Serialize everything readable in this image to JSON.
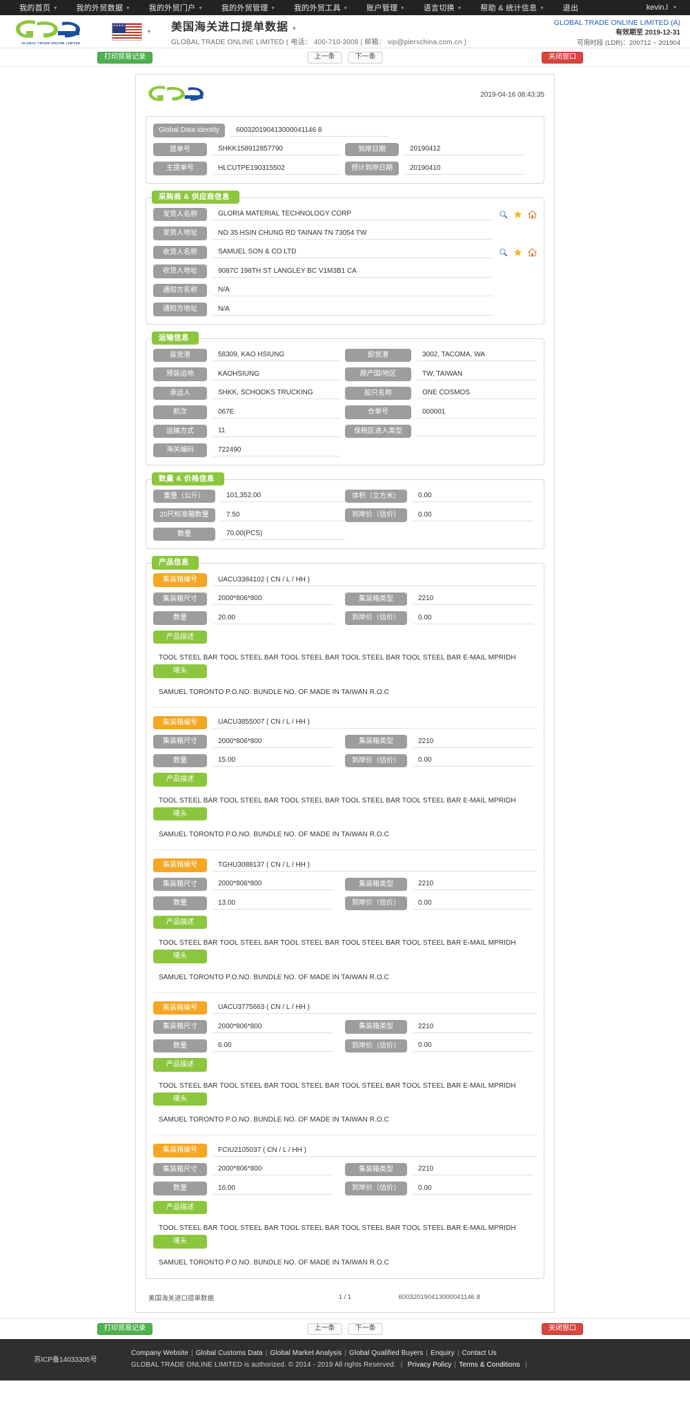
{
  "topnav": {
    "items": [
      {
        "label": "我的首页",
        "caret": true
      },
      {
        "label": "我的外贸数据",
        "caret": true
      },
      {
        "label": "我的外贸门户",
        "caret": true
      },
      {
        "label": "我的外贸管理",
        "caret": true
      },
      {
        "label": "我的外贸工具",
        "caret": true
      },
      {
        "label": "账户管理",
        "caret": true
      },
      {
        "label": "语言切换",
        "caret": true
      },
      {
        "label": "帮助 & 统计信息",
        "caret": true
      },
      {
        "label": "退出",
        "caret": false
      }
    ],
    "user": "kevin.l",
    "user_caret": "▾"
  },
  "brand": {
    "logo_text": "GLOBAL TRADE ONLINE LIMITED",
    "flag_name": "us-flag",
    "title": "美国海关进口提单数据",
    "title_caret": "▾",
    "subtitle": "GLOBAL TRADE ONLINE LIMITED ( 电话： 400-710-3008 | 邮箱： vip@pierschina.com.cn )",
    "account_name": "GLOBAL TRADE ONLINE LIMITED (A)",
    "account_valid": "有效期至 2019-12-31",
    "account_ldr": "可用时段 (LDR)：200712 ~ 201904"
  },
  "toolbar": {
    "print_label": "打印贸易记录",
    "prev_label": "上一条",
    "next_label": "下一条",
    "close_label": "关闭窗口"
  },
  "doc": {
    "timestamp": "2019-04-16 08:43:35",
    "identity": {
      "label": "Global Data Identity",
      "value": "600320190413000041146 8"
    },
    "header_fields": [
      {
        "label": "提单号",
        "value": "SHKK158912857790",
        "label2": "到岸日期",
        "value2": "20190412"
      },
      {
        "label": "主提单号",
        "value": "HLCUTPE190315502",
        "label2": "预计到岸日期",
        "value2": "20190410"
      }
    ],
    "buyer_section": {
      "title": "采购商 & 供应商信息",
      "rows": [
        {
          "label": "发货人名称",
          "value": "GLORIA MATERIAL TECHNOLOGY CORP",
          "icons": true
        },
        {
          "label": "发货人地址",
          "value": "NO 35 HSIN CHUNG RD TAINAN TN 73054 TW",
          "icons": false
        },
        {
          "label": "收货人名称",
          "value": "SAMUEL SON & CO LTD",
          "icons": true
        },
        {
          "label": "收货人地址",
          "value": "9087C 198TH ST LANGLEY BC V1M3B1 CA",
          "icons": false
        },
        {
          "label": "通知方名称",
          "value": "N/A",
          "icons": false
        },
        {
          "label": "通知方地址",
          "value": "N/A",
          "icons": false
        }
      ]
    },
    "transport_section": {
      "title": "运输信息",
      "rows": [
        {
          "label": "装货港",
          "value": "58309, KAO HSIUNG",
          "label2": "卸货港",
          "value2": "3002, TACOMA, WA"
        },
        {
          "label": "预装运地",
          "value": "KAOHSIUNG",
          "label2": "原产国/地区",
          "value2": "TW, TAIWAN"
        },
        {
          "label": "承运人",
          "value": "SHKK, SCHOOKS TRUCKING",
          "label2": "船只名称",
          "value2": "ONE COSMOS"
        },
        {
          "label": "航次",
          "value": "067E",
          "label2": "仓单号",
          "value2": "000001"
        },
        {
          "label": "运输方式",
          "value": "11",
          "label2": "保税区进入类型",
          "value2": ""
        },
        {
          "label": "海关编码",
          "value": "722490",
          "label2": "",
          "value2": ""
        }
      ]
    },
    "quantity_section": {
      "title": "数量 & 价格信息",
      "rows": [
        {
          "label": "重量（公斤）",
          "value": "101,352.00",
          "label2": "体积（立方米）",
          "value2": "0.00"
        },
        {
          "label": "20尺标准箱数量",
          "value": "7.50",
          "label2": "到岸价（估价）",
          "value2": "0.00"
        },
        {
          "label": "数量",
          "value": "70.00(PCS)",
          "label2": "",
          "value2": ""
        }
      ]
    },
    "product_section": {
      "title": "产品信息",
      "labels": {
        "container_no": "集装箱编号",
        "container_size": "集装箱尺寸",
        "container_type": "集装箱类型",
        "quantity": "数量",
        "price": "到岸价（估价）",
        "description": "产品描述",
        "marks": "唛头"
      },
      "items": [
        {
          "container_no": "UACU3384102 ( CN / L / HH )",
          "container_size": "2000*806*800",
          "container_type": "2210",
          "quantity": "20.00",
          "price": "0.00",
          "description": "TOOL STEEL BAR TOOL STEEL BAR TOOL STEEL BAR TOOL STEEL BAR TOOL STEEL BAR E-MAIL MPRIDH",
          "marks": "SAMUEL TORONTO P.O.NO. BUNDLE NO. OF MADE IN TAIWAN R.O.C"
        },
        {
          "container_no": "UACU3855007 ( CN / L / HH )",
          "container_size": "2000*806*800",
          "container_type": "2210",
          "quantity": "15.00",
          "price": "0.00",
          "description": "TOOL STEEL BAR TOOL STEEL BAR TOOL STEEL BAR TOOL STEEL BAR TOOL STEEL BAR E-MAIL MPRIDH",
          "marks": "SAMUEL TORONTO P.O.NO. BUNDLE NO. OF MADE IN TAIWAN R.O.C"
        },
        {
          "container_no": "TGHU3088137 ( CN / L / HH )",
          "container_size": "2000*806*800",
          "container_type": "2210",
          "quantity": "13.00",
          "price": "0.00",
          "description": "TOOL STEEL BAR TOOL STEEL BAR TOOL STEEL BAR TOOL STEEL BAR TOOL STEEL BAR E-MAIL MPRIDH",
          "marks": "SAMUEL TORONTO P.O.NO. BUNDLE NO. OF MADE IN TAIWAN R.O.C"
        },
        {
          "container_no": "UACU3775663 ( CN / L / HH )",
          "container_size": "2000*806*800",
          "container_type": "2210",
          "quantity": "6.00",
          "price": "0.00",
          "description": "TOOL STEEL BAR TOOL STEEL BAR TOOL STEEL BAR TOOL STEEL BAR TOOL STEEL BAR E-MAIL MPRIDH",
          "marks": "SAMUEL TORONTO P.O.NO. BUNDLE NO. OF MADE IN TAIWAN R.O.C"
        },
        {
          "container_no": "FCIU2105037 ( CN / L / HH )",
          "container_size": "2000*806*800",
          "container_type": "2210",
          "quantity": "16.00",
          "price": "0.00",
          "description": "TOOL STEEL BAR TOOL STEEL BAR TOOL STEEL BAR TOOL STEEL BAR TOOL STEEL BAR E-MAIL MPRIDH",
          "marks": "SAMUEL TORONTO P.O.NO. BUNDLE NO. OF MADE IN TAIWAN R.O.C"
        }
      ]
    },
    "footer": {
      "left": "美国海关进口提单数据",
      "page": "1 / 1",
      "right": "600320190413000041146 8"
    }
  },
  "icons": {
    "search": "search-icon",
    "star": "star-icon",
    "home": "home-icon"
  },
  "colors": {
    "green": "#8cc63e",
    "orange": "#f5a623",
    "gray_label": "#9d9d9d",
    "btn_green": "#4fb04f",
    "btn_red": "#d9453f",
    "link_blue": "#1f5fbf"
  },
  "site_footer": {
    "icp": "苏ICP备14033305号",
    "links": [
      "Company Website",
      "Global Customs Data",
      "Global Market Analysis",
      "Global Qualified Buyers",
      "Enquiry",
      "Contact Us"
    ],
    "copyright": "GLOBAL TRADE ONLINE LIMITED is authorized. © 2014 - 2019 All rights Reserved.",
    "legal_open": "(",
    "legal_links": [
      "Privacy Policy",
      "Terms & Conditions"
    ],
    "legal_close": ")"
  }
}
